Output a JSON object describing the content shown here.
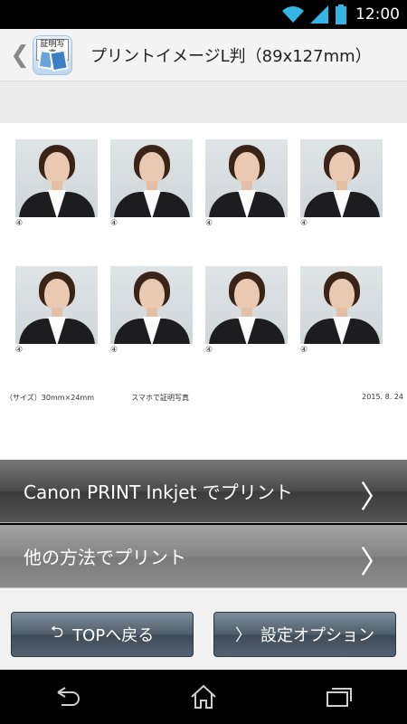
{
  "status_bar": {
    "time": "12:00"
  },
  "header": {
    "back_symbol": "❮",
    "app_icon_label": "証明写真",
    "title": "プリントイメージL判（89x127mm）"
  },
  "sheet": {
    "photos": [
      {
        "label": "④"
      },
      {
        "label": "④"
      },
      {
        "label": "④"
      },
      {
        "label": "④"
      },
      {
        "label": "④"
      },
      {
        "label": "④"
      },
      {
        "label": "④"
      },
      {
        "label": "④"
      }
    ],
    "footer_size": "（サイズ）30mm×24mm",
    "footer_app": "スマホで証明写真",
    "footer_date": "2015. 8. 24"
  },
  "actions": {
    "canon_label": "Canon PRINT Inkjet でプリント",
    "other_label": "他の方法でプリント",
    "arrow": "〉"
  },
  "bottom_nav": {
    "top_label": "TOPへ戻る",
    "top_symbol": "⮌",
    "settings_label": "設定オプション",
    "settings_symbol": "〉"
  },
  "colors": {
    "status_bar_icons": "#33b5e5"
  }
}
